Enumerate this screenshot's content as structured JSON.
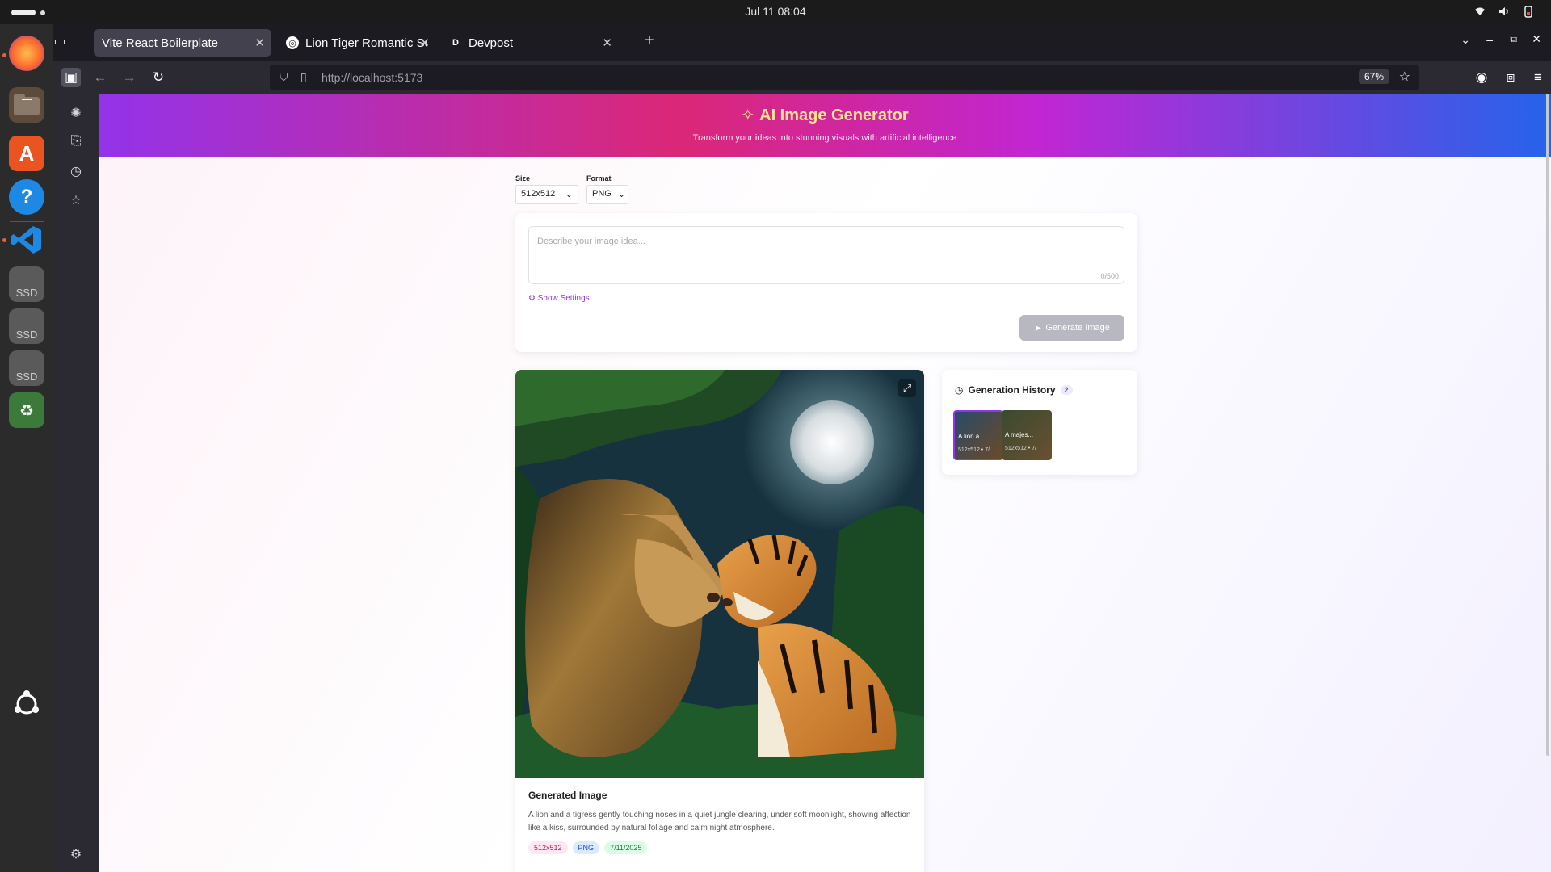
{
  "system": {
    "clock": "Jul 11  08:04"
  },
  "browser": {
    "tabs": [
      {
        "label": "Vite React Boilerplate",
        "active": true
      },
      {
        "label": "Lion Tiger Romantic Scen",
        "active": false
      },
      {
        "label": "Devpost",
        "active": false,
        "favicon_letter": "D"
      }
    ],
    "url": "http://localhost:5173",
    "zoom": "67%"
  },
  "app": {
    "title": "AI Image Generator",
    "subtitle": "Transform your ideas into stunning visuals with artificial intelligence",
    "size": {
      "label": "Size",
      "value": "512x512"
    },
    "format": {
      "label": "Format",
      "value": "PNG"
    },
    "prompt": {
      "placeholder": "Describe your image idea...",
      "counter": "0/500"
    },
    "show_settings": "Show Settings",
    "generate_label": "Generate Image",
    "result": {
      "title": "Generated Image",
      "description": "A lion and a tigress gently touching noses in a quiet jungle clearing, under soft moonlight, showing affection like a kiss, surrounded by natural foliage and calm night atmosphere.",
      "chips": [
        "512x512",
        "PNG",
        "7/11/2025"
      ]
    },
    "history": {
      "title": "Generation History",
      "count": "2",
      "items": [
        {
          "caption": "A lion a...",
          "meta": "512x512 • 7/"
        },
        {
          "caption": "A majes...",
          "meta": "512x512 • 7/"
        }
      ]
    }
  },
  "colors": {
    "accent": "#9333ea",
    "hero_title": "#fde68a"
  }
}
